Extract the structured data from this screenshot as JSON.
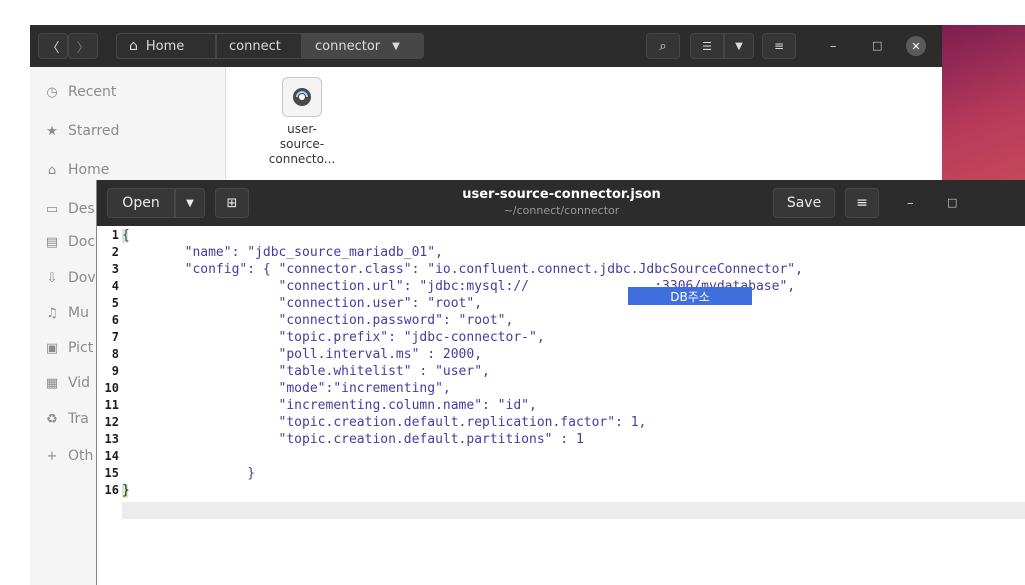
{
  "file_manager": {
    "breadcrumb_home": "Home",
    "breadcrumb_1": "connect",
    "breadcrumb_2": "connector",
    "sidebar": [
      {
        "label": "Recent",
        "icon": "clock-icon"
      },
      {
        "label": "Starred",
        "icon": "star-icon"
      },
      {
        "label": "Home",
        "icon": "home-icon"
      },
      {
        "label": "Des",
        "icon": "desktop-icon"
      },
      {
        "label": "Doc",
        "icon": "document-icon"
      },
      {
        "label": "Dov",
        "icon": "download-icon"
      },
      {
        "label": "Mu",
        "icon": "music-icon"
      },
      {
        "label": "Pict",
        "icon": "picture-icon"
      },
      {
        "label": "Vid",
        "icon": "video-icon"
      },
      {
        "label": "Tra",
        "icon": "trash-icon"
      },
      {
        "label": "Oth",
        "icon": "plus-icon"
      }
    ],
    "file": {
      "name_lines": [
        "user-",
        "source-",
        "connecto..."
      ]
    }
  },
  "editor": {
    "open_label": "Open",
    "save_label": "Save",
    "title": "user-source-connector.json",
    "subtitle": "~/connect/connector",
    "redaction_label": "DB주소",
    "line_numbers": [
      "1",
      "2",
      "3",
      "4",
      "5",
      "6",
      "7",
      "8",
      "9",
      "10",
      "11",
      "12",
      "13",
      "14",
      "15",
      "16"
    ],
    "lines": [
      "{",
      "        \"name\": \"jdbc_source_mariadb_01\",",
      "        \"config\": { \"connector.class\": \"io.confluent.connect.jdbc.JdbcSourceConnector\",",
      "                    \"connection.url\": \"jdbc:mysql://                :3306/mydatabase\",",
      "                    \"connection.user\": \"root\",",
      "                    \"connection.password\": \"root\",",
      "                    \"topic.prefix\": \"jdbc-connector-\",",
      "                    \"poll.interval.ms\" : 2000,",
      "                    \"table.whitelist\" : \"user\",",
      "                    \"mode\":\"incrementing\",",
      "                    \"incrementing.column.name\": \"id\",",
      "                    \"topic.creation.default.replication.factor\": 1,",
      "                    \"topic.creation.default.partitions\" : 1",
      "",
      "                }",
      "}"
    ]
  }
}
